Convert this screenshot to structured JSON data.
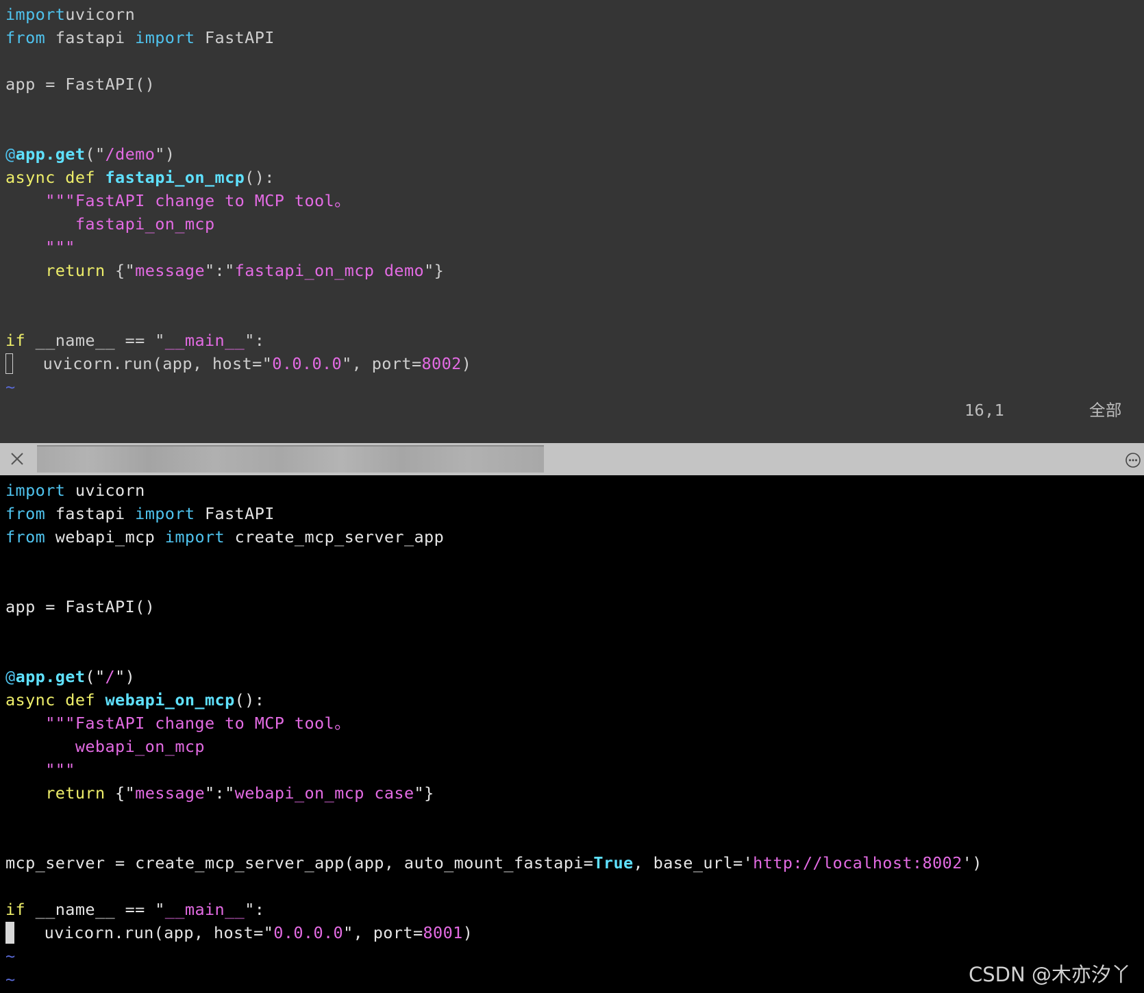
{
  "top_pane": {
    "lines": [
      [
        [
          "kw-blue",
          "import"
        ],
        [
          "",
          "uvicorn"
        ]
      ],
      [
        [
          "kw-blue",
          "from"
        ],
        [
          "",
          " fastapi "
        ],
        [
          "kw-blue",
          "import"
        ],
        [
          "",
          " FastAPI"
        ]
      ],
      [],
      [
        [
          "",
          "app = FastAPI()"
        ]
      ],
      [],
      [],
      [
        [
          "kw-blue",
          "@"
        ],
        [
          "fn-cyan",
          "app.get"
        ],
        [
          "",
          "(\""
        ],
        [
          "str",
          "/demo"
        ],
        [
          "",
          "\")"
        ]
      ],
      [
        [
          "kw-yellow",
          "async def "
        ],
        [
          "fn-cyan",
          "fastapi_on_mcp"
        ],
        [
          "",
          "():"
        ]
      ],
      [
        [
          "",
          "    "
        ],
        [
          "str",
          "\"\"\"FastAPI change to MCP tool。"
        ]
      ],
      [
        [
          "str",
          "       fastapi_on_mcp"
        ]
      ],
      [
        [
          "str",
          "    \"\"\""
        ]
      ],
      [
        [
          "",
          "    "
        ],
        [
          "kw-yellow",
          "return"
        ],
        [
          "",
          " {\""
        ],
        [
          "str",
          "message"
        ],
        [
          "",
          "\":\""
        ],
        [
          "str",
          "fastapi_on_mcp demo"
        ],
        [
          "",
          "\"}"
        ]
      ],
      [],
      [],
      [
        [
          "kw-yellow",
          "if"
        ],
        [
          "",
          " __name__ == \""
        ],
        [
          "str",
          "__main__"
        ],
        [
          "",
          "\":"
        ]
      ],
      [
        [
          "cursor-hollow",
          ""
        ],
        [
          "",
          "   uvicorn.run(app, host=\""
        ],
        [
          "str",
          "0.0.0.0"
        ],
        [
          "",
          "\", port="
        ],
        [
          "num",
          "8002"
        ],
        [
          "",
          ")"
        ]
      ],
      [
        [
          "tilde",
          "~"
        ]
      ]
    ],
    "status_position": "16,1",
    "status_all": "全部"
  },
  "tab_bar": {
    "close_icon": "close-icon",
    "more_icon": "more-options-icon"
  },
  "bottom_pane": {
    "lines": [
      [
        [
          "kw-blue",
          "import"
        ],
        [
          "",
          " uvicorn"
        ]
      ],
      [
        [
          "kw-blue",
          "from"
        ],
        [
          "",
          " fastapi "
        ],
        [
          "kw-blue",
          "import"
        ],
        [
          "",
          " FastAPI"
        ]
      ],
      [
        [
          "kw-blue",
          "from"
        ],
        [
          "",
          " webapi_mcp "
        ],
        [
          "kw-blue",
          "import"
        ],
        [
          "",
          " create_mcp_server_app"
        ]
      ],
      [],
      [],
      [
        [
          "",
          "app = FastAPI()"
        ]
      ],
      [],
      [],
      [
        [
          "kw-blue",
          "@"
        ],
        [
          "fn-cyan",
          "app.get"
        ],
        [
          "",
          "(\""
        ],
        [
          "str",
          "/"
        ],
        [
          "",
          "\")"
        ]
      ],
      [
        [
          "kw-yellow",
          "async def "
        ],
        [
          "fn-cyan",
          "webapi_on_mcp"
        ],
        [
          "",
          "():"
        ]
      ],
      [
        [
          "",
          "    "
        ],
        [
          "str",
          "\"\"\"FastAPI change to MCP tool。"
        ]
      ],
      [
        [
          "str",
          "       webapi_on_mcp"
        ]
      ],
      [
        [
          "str",
          "    \"\"\""
        ]
      ],
      [
        [
          "",
          "    "
        ],
        [
          "kw-yellow",
          "return"
        ],
        [
          "",
          " {\""
        ],
        [
          "str",
          "message"
        ],
        [
          "",
          "\":\""
        ],
        [
          "str",
          "webapi_on_mcp case"
        ],
        [
          "",
          "\"}"
        ]
      ],
      [],
      [],
      [
        [
          "",
          "mcp_server = create_mcp_server_app(app, auto_mount_fastapi="
        ],
        [
          "true-cyan",
          "True"
        ],
        [
          "",
          ", base_url='"
        ],
        [
          "str",
          "http://localhost:8002"
        ],
        [
          "",
          "')"
        ]
      ],
      [],
      [
        [
          "kw-yellow",
          "if"
        ],
        [
          "",
          " __name__ == \""
        ],
        [
          "str",
          "__main__"
        ],
        [
          "",
          "\":"
        ]
      ],
      [
        [
          "cursor-solid",
          ""
        ],
        [
          "",
          "   uvicorn.run(app, host=\""
        ],
        [
          "str",
          "0.0.0.0"
        ],
        [
          "",
          "\", port="
        ],
        [
          "num",
          "8001"
        ],
        [
          "",
          ")"
        ]
      ],
      [
        [
          "tilde",
          "~"
        ]
      ],
      [
        [
          "tilde",
          "~"
        ]
      ]
    ]
  },
  "watermark": "CSDN @木亦汐丫"
}
